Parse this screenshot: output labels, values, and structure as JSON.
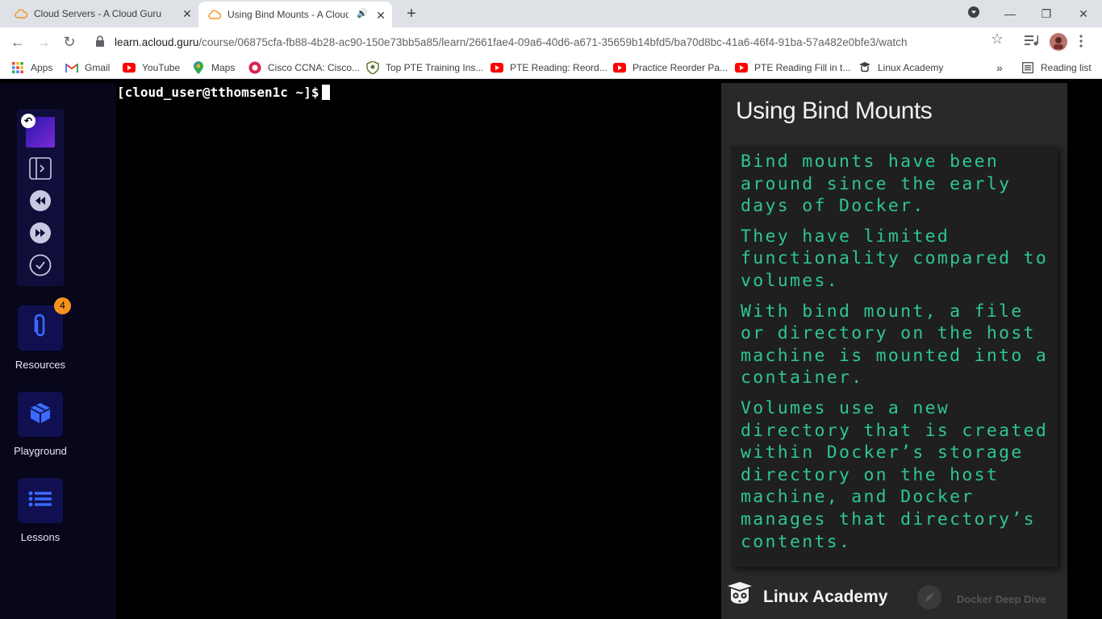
{
  "browser": {
    "tabs": [
      {
        "title": "Cloud Servers - A Cloud Guru",
        "active": false
      },
      {
        "title": "Using Bind Mounts - A Cloud Guru",
        "active": true
      }
    ],
    "url_host": "learn.acloud.guru",
    "url_path": "/course/06875cfa-fb88-4b28-ac90-150e73bb5a85/learn/2661fae4-09a6-40d6-a671-35659b14bfd5/ba70d8bc-41a6-46f4-91ba-57a482e0bfe3/watch",
    "bookmarks": [
      {
        "label": "Apps",
        "icon": "apps-grid-icon"
      },
      {
        "label": "Gmail",
        "icon": "gmail-icon"
      },
      {
        "label": "YouTube",
        "icon": "youtube-icon"
      },
      {
        "label": "Maps",
        "icon": "maps-icon"
      },
      {
        "label": "Cisco CCNA: Cisco...",
        "icon": "cisco-icon"
      },
      {
        "label": "Top PTE Training Ins...",
        "icon": "pte-icon"
      },
      {
        "label": "PTE Reading: Reord...",
        "icon": "youtube-icon"
      },
      {
        "label": "Practice Reorder Pa...",
        "icon": "youtube-icon"
      },
      {
        "label": "PTE Reading Fill in t...",
        "icon": "youtube-icon"
      },
      {
        "label": "Linux Academy",
        "icon": "linux-academy-icon"
      }
    ],
    "more_bookmarks": "»",
    "reading_list": "Reading list"
  },
  "sidebar": {
    "resources_label": "Resources",
    "resources_badge": "4",
    "playground_label": "Playground",
    "lessons_label": "Lessons"
  },
  "terminal": {
    "prompt": "[cloud_user@tthomsen1c ~]$"
  },
  "slide": {
    "title": "Using Bind Mounts",
    "paragraphs": [
      "Bind mounts have been around since the early days of Docker.",
      "They have limited functionality compared to volumes.",
      "With bind mount, a file or directory on the host machine is mounted into a container.",
      "Volumes use a new directory that is created within Docker’s storage directory on the host machine, and Docker manages that directory’s contents."
    ],
    "brand": "Linux Academy",
    "course": "Docker Deep Dive"
  },
  "colors": {
    "sidebar_bg": "#07061a",
    "sidebar_button": "#101050",
    "accent_blue": "#3b5bfd",
    "badge": "#f7931e",
    "slide_text": "#2ec596"
  }
}
